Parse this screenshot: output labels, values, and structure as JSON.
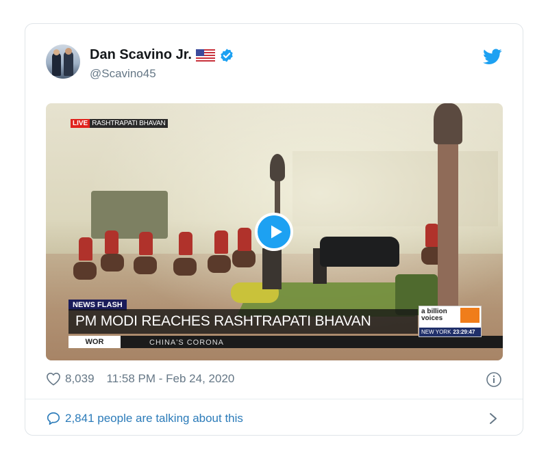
{
  "author": {
    "name": "Dan Scavino Jr.",
    "handle": "@Scavino45",
    "flag_icon": "us-flag-icon",
    "verified_icon": "verified-badge-icon"
  },
  "media": {
    "live_label": "LIVE",
    "location_label": "RASHTRAPATI BHAVAN",
    "news_flash_label": "NEWS FLASH",
    "headline": "PM MODI REACHES RASHTRAPATI BHAVAN",
    "ticker_logo": "WOR",
    "ticker_text": "CHINA'S CORONA",
    "brand_line1": "a billion",
    "brand_line2": "voices",
    "brand_city": "NEW YORK",
    "brand_time": "23:29:47"
  },
  "stats": {
    "likes": "8,039",
    "timestamp": "11:58 PM - Feb 24, 2020"
  },
  "footer": {
    "talking_text": "2,841 people are talking about this"
  },
  "colors": {
    "accent": "#1da1f2",
    "link": "#2b7bb9",
    "muted": "#657786"
  }
}
